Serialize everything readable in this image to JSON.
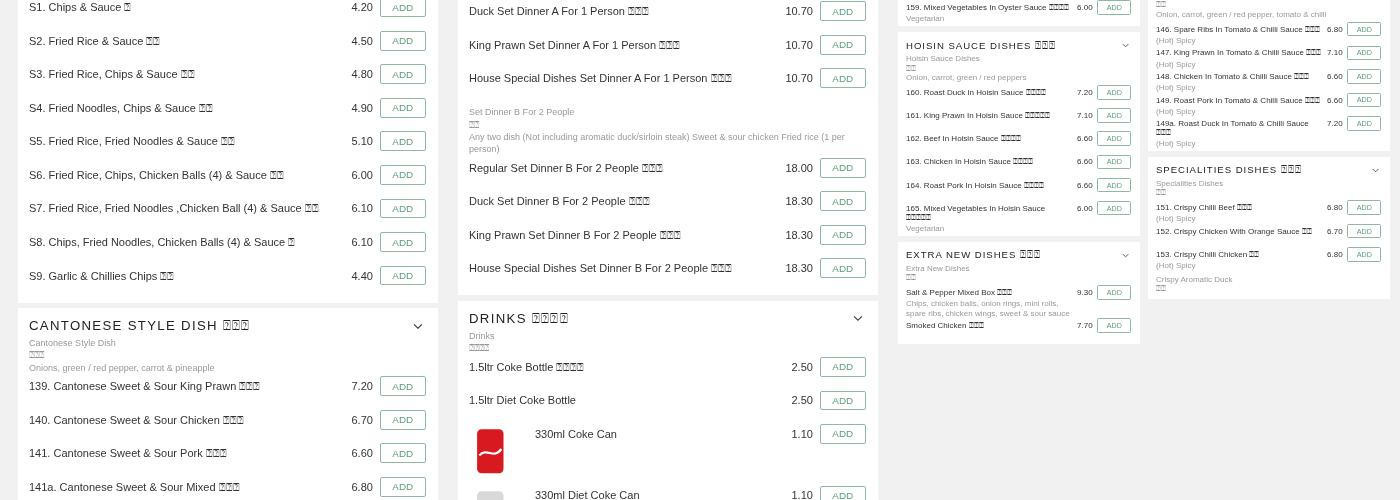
{
  "columns": [
    {
      "panels": [
        {
          "items": [
            {
              "kind": "item",
              "name": "S1. Chips & Sauce ⍰",
              "price": "4.20",
              "button": "ADD"
            },
            {
              "kind": "item",
              "name": "S2. Fried Rice & Sauce ⍰⍰",
              "price": "4.50",
              "button": "ADD"
            },
            {
              "kind": "item",
              "name": "S3. Fried Rice, Chips & Sauce ⍰⍰",
              "price": "4.80",
              "button": "ADD"
            },
            {
              "kind": "item",
              "name": "S4. Fried Noodles, Chips & Sauce ⍰⍰",
              "price": "4.90",
              "button": "ADD"
            },
            {
              "kind": "item",
              "name": "S5. Fried Rice, Fried Noodles & Sauce ⍰⍰",
              "price": "5.10",
              "button": "ADD"
            },
            {
              "kind": "item",
              "name": "S6. Fried Rice, Chips, Chicken Balls (4) & Sauce ⍰⍰",
              "price": "6.00",
              "button": "ADD"
            },
            {
              "kind": "item",
              "name": "S7. Fried Rice, Fried Noodles ,Chicken Ball (4) & Sauce ⍰⍰",
              "price": "6.10",
              "button": "ADD"
            },
            {
              "kind": "item",
              "name": "S8. Chips, Fried Noodles, Chicken Balls (4) & Sauce ⍰",
              "price": "6.10",
              "button": "ADD"
            },
            {
              "kind": "item",
              "name": "S9. Garlic & Chillies Chips ⍰⍰",
              "price": "4.40",
              "button": "ADD"
            }
          ]
        },
        {
          "title": "CANTONESE STYLE DISH ⍰⍰⍰",
          "description": [
            "Cantonese Style Dish",
            "⍰⍰⍰",
            "Onions, green / red pepper, carrot & pineapple"
          ],
          "items": [
            {
              "kind": "item",
              "name": "139. Cantonese Sweet & Sour King Prawn ⍰⍰⍰",
              "price": "7.20",
              "button": "ADD"
            },
            {
              "kind": "item",
              "name": "140. Cantonese Sweet & Sour Chicken ⍰⍰⍰",
              "price": "6.70",
              "button": "ADD"
            },
            {
              "kind": "item",
              "name": "141. Cantonese Sweet & Sour Pork ⍰⍰⍰",
              "price": "6.60",
              "button": "ADD"
            },
            {
              "kind": "item",
              "name": "141a. Cantonese Sweet & Sour Mixed ⍰⍰⍰",
              "price": "6.80",
              "button": "ADD"
            }
          ]
        }
      ]
    },
    {
      "panels": [
        {
          "items": [
            {
              "kind": "item",
              "name": "Duck Set Dinner A For 1 Person ⍰⍰⍰",
              "price": "10.70",
              "button": "ADD"
            },
            {
              "kind": "item",
              "name": "King Prawn Set Dinner A For 1 Person ⍰⍰⍰",
              "price": "10.70",
              "button": "ADD"
            },
            {
              "kind": "item",
              "name": "House Special Dishes Set Dinner A For 1 Person ⍰⍰⍰",
              "price": "10.70",
              "button": "ADD"
            },
            {
              "kind": "group_info",
              "lines": [
                "Set Dinner B For 2 People",
                "⍰⍰",
                "Any two dish (Not including aromatic duck/sirloin steak) Sweet & sour chicken Fried rice (1 per person)"
              ]
            },
            {
              "kind": "item",
              "name": "Regular Set Dinner B For 2 People ⍰⍰⍰",
              "price": "18.00",
              "button": "ADD"
            },
            {
              "kind": "item",
              "name": "Duck Set Dinner B For 2 People ⍰⍰⍰",
              "price": "18.30",
              "button": "ADD"
            },
            {
              "kind": "item",
              "name": "King Prawn Set Dinner B For 2 People ⍰⍰⍰",
              "price": "18.30",
              "button": "ADD"
            },
            {
              "kind": "item",
              "name": "House Special Dishes Set Dinner B For 2 People ⍰⍰⍰",
              "price": "18.30",
              "button": "ADD"
            }
          ]
        },
        {
          "title": "DRINKS ⍰⍰⍰⍰",
          "description": [
            "Drinks",
            "⍰⍰⍰⍰"
          ],
          "items": [
            {
              "kind": "item",
              "name": "1.5ltr Coke Bottle ⍰⍰⍰⍰",
              "price": "2.50",
              "button": "ADD"
            },
            {
              "kind": "item",
              "name": "1.5ltr Diet Coke Bottle",
              "price": "2.50",
              "button": "ADD"
            },
            {
              "kind": "photo_item",
              "name": "330ml Coke Can",
              "price": "1.10",
              "button": "ADD",
              "color": "#d71920"
            },
            {
              "kind": "photo_item",
              "name": "330ml Diet Coke Can",
              "price": "1.10",
              "button": "ADD",
              "color": "#d9d9d9"
            }
          ]
        }
      ]
    },
    {
      "panels": [
        {
          "items": [
            {
              "kind": "item",
              "name": "159. Mixed Vegetables In Oyster Sauce ⍰⍰⍰⍰",
              "note": "Vegetarian",
              "price": "6.00",
              "button": "ADD"
            }
          ]
        },
        {
          "title": "HOISIN SAUCE DISHES ⍰⍰⍰",
          "description": [
            "Hoisin Sauce Dishes",
            "⍰⍰",
            "Onion, carrot, green / red peppers"
          ],
          "items": [
            {
              "kind": "item",
              "name": "160. Roast Duck In Hoisin Sauce ⍰⍰⍰⍰",
              "price": "7.20",
              "button": "ADD"
            },
            {
              "kind": "item",
              "name": "161. King Prawn In Hoisin Sauce ⍰⍰⍰⍰⍰",
              "price": "7.10",
              "button": "ADD"
            },
            {
              "kind": "item",
              "name": "162. Beef In Hoisin Sauce ⍰⍰⍰⍰",
              "price": "6.60",
              "button": "ADD"
            },
            {
              "kind": "item",
              "name": "163. Chicken In Hoisin Sauce ⍰⍰⍰⍰",
              "price": "6.60",
              "button": "ADD"
            },
            {
              "kind": "item",
              "name": "164. Roast Pork In Hoisin Sauce ⍰⍰⍰⍰",
              "price": "6.60",
              "button": "ADD"
            },
            {
              "kind": "item",
              "name": "165. Mixed Vegetables In Hoisin Sauce ⍰⍰⍰⍰⍰",
              "note": "Vegetarian",
              "price": "6.00",
              "button": "ADD"
            }
          ]
        },
        {
          "title": "EXTRA NEW DISHES ⍰⍰⍰",
          "description": [
            "Extra New Dishes",
            "⍰⍰"
          ],
          "items": [
            {
              "kind": "item",
              "name": "Salt & Pepper Mixed Box ⍰⍰⍰",
              "note": "Chips, chicken balls, onion rings, mini rolls, spare ribs, chicken wings, sweet & sour sauce",
              "price": "9.30",
              "button": "ADD"
            },
            {
              "kind": "item",
              "name": "Smoked Chicken ⍰⍰⍰",
              "price": "7.70",
              "button": "ADD"
            }
          ]
        },
        {
          "description": [
            "⍰⍰",
            "Onion, carrot, green / red pepper, tomato & chilli"
          ],
          "items": [
            {
              "kind": "item",
              "name": "146. Spare Ribs In Tomato & Chilli Sauce ⍰⍰⍰",
              "note": "(Hot) Spicy",
              "price": "6.80",
              "button": "ADD"
            },
            {
              "kind": "item",
              "name": "147. King Prawn In Tomato & Chilli Sauce ⍰⍰⍰",
              "note": "(Hot) Spicy",
              "price": "7.10",
              "button": "ADD"
            },
            {
              "kind": "item",
              "name": "148. Chicken In Tomato & Chilli Sauce ⍰⍰⍰",
              "note": "(Hot) Spicy",
              "price": "6.60",
              "button": "ADD"
            },
            {
              "kind": "item",
              "name": "149. Roast Pork In Tomato & Chilli Sauce ⍰⍰⍰",
              "note": "(Hot) Spicy",
              "price": "6.60",
              "button": "ADD"
            },
            {
              "kind": "item",
              "name": "149a. Roast Duck In Tomato & Chilli Sauce ⍰⍰⍰",
              "note": "(Hot) Spicy",
              "price": "7.20",
              "button": "ADD"
            }
          ]
        },
        {
          "title": "SPECIALITIES DISHES ⍰⍰⍰",
          "description": [
            "Specialities Dishes",
            "⍰⍰"
          ],
          "items": [
            {
              "kind": "item",
              "name": "151. Crispy Chilli Beef ⍰⍰⍰",
              "note": "(Hot) Spicy",
              "price": "6.80",
              "button": "ADD"
            },
            {
              "kind": "item",
              "name": "152. Crispy Chicken With Orange Sauce ⍰⍰",
              "price": "6.70",
              "button": "ADD"
            },
            {
              "kind": "item",
              "name": "153. Crispy Chilli Chicken ⍰⍰",
              "note": "(Hot) Spicy",
              "price": "6.80",
              "button": "ADD"
            },
            {
              "kind": "group_info",
              "lines": [
                "Crispy Aromatic Duck",
                "⍰⍰"
              ]
            }
          ]
        }
      ]
    }
  ]
}
